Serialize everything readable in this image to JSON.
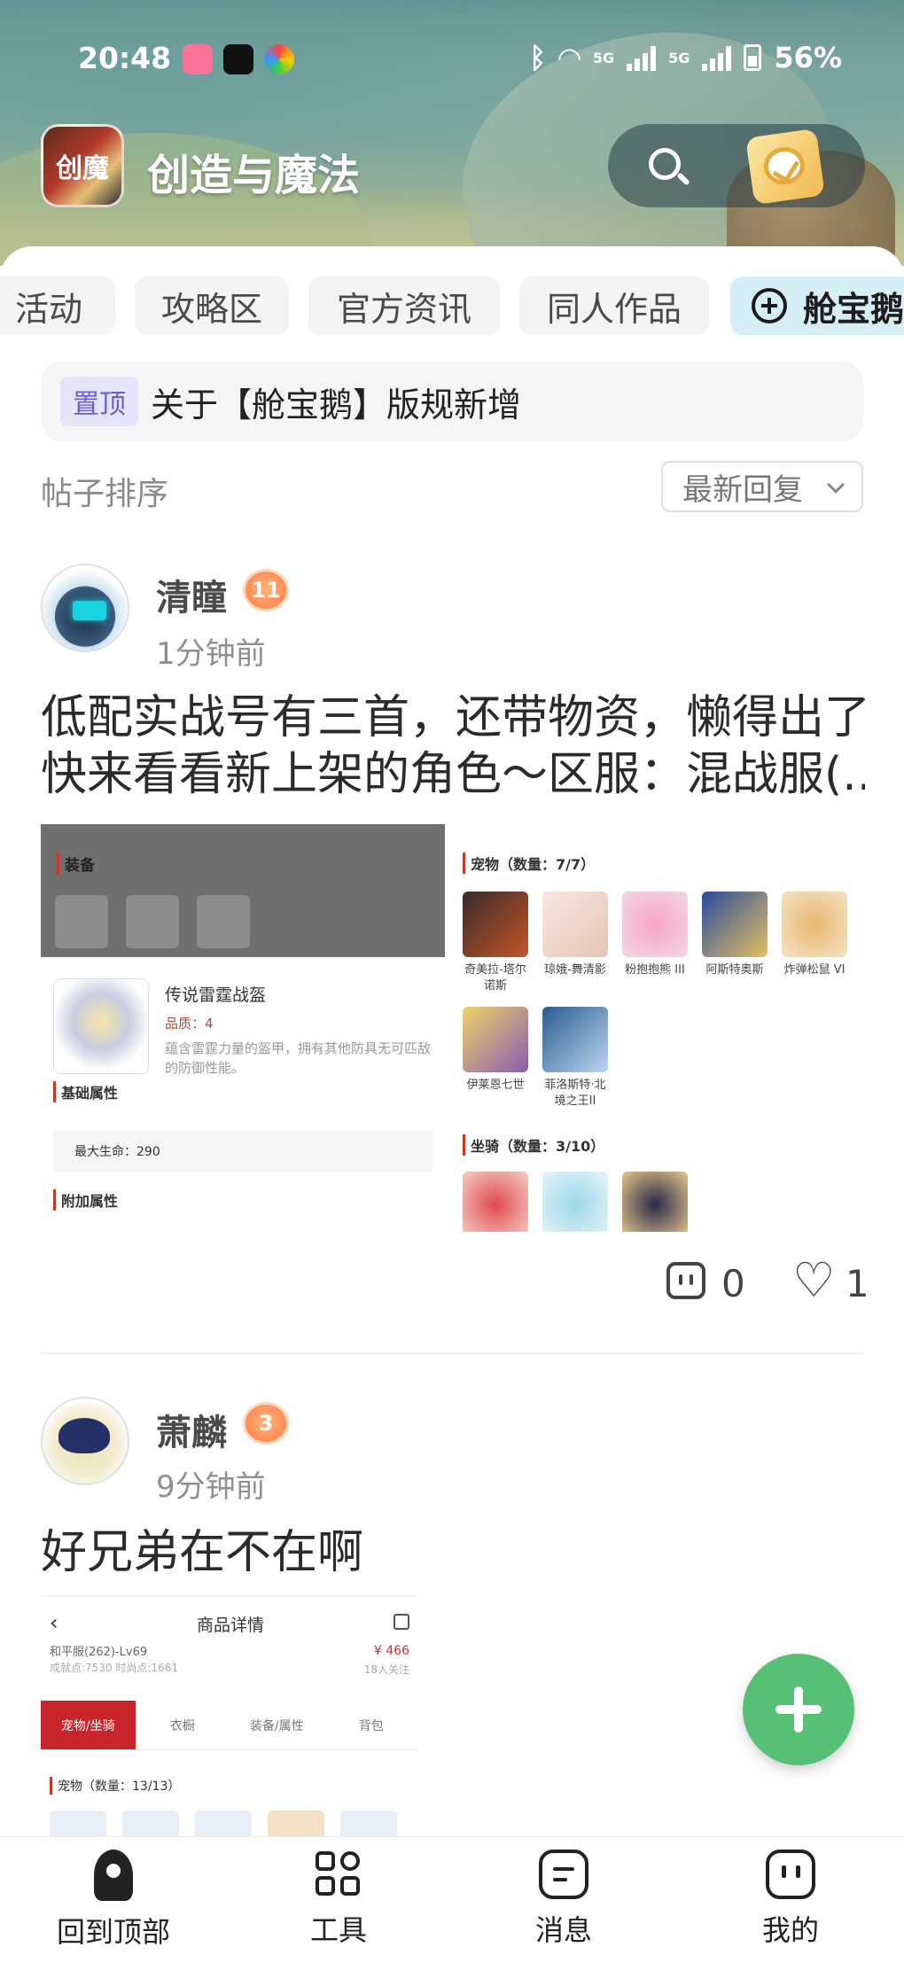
{
  "status_bar": {
    "time": "20:48",
    "network_1": "5G",
    "network_2": "5G",
    "battery": "56%"
  },
  "header": {
    "app_title": "创造与魔法",
    "logo_text": "创魔"
  },
  "tabs": [
    {
      "label": "活动"
    },
    {
      "label": "攻略区"
    },
    {
      "label": "官方资讯"
    },
    {
      "label": "同人作品"
    },
    {
      "label": "舱宝鹅",
      "active": true
    }
  ],
  "pinned": {
    "badge": "置顶",
    "text": "关于【舱宝鹅】版规新增"
  },
  "sort": {
    "label": "帖子排序",
    "selected": "最新回复"
  },
  "posts": [
    {
      "username": "清瞳",
      "level": "11",
      "time": "1分钟前",
      "text_line1": "低配实战号有三首，还带物资，懒得出了",
      "text_line2": "快来看看新上架的角色～区服：混战服(...",
      "comments": "0",
      "likes": "1",
      "screenshot": {
        "equip_title": "装备",
        "item_name": "传说雷霆战盔",
        "quality": "品质：4",
        "description": "蕴含雷霆力量的盔甲，拥有其他防具无可匹敌的防御性能。",
        "base_attr_title": "基础属性",
        "base_attr_row": "最大生命：290",
        "extra_attr_title": "附加属性",
        "pets_title": "宠物（数量：7/7）",
        "pets": [
          "奇美拉-塔尔诺斯",
          "琼娥-舞清影",
          "粉抱抱熊 III",
          "阿斯特奥斯",
          "炸弹松鼠 VI",
          "伊莱恩七世",
          "菲洛斯特·北境之王II"
        ],
        "mounts_title": "坐骑（数量：3/10）"
      }
    },
    {
      "username": "萧麟",
      "level": "3",
      "time": "9分钟前",
      "text_line1": "好兄弟在不在啊",
      "screenshot": {
        "back": "‹",
        "title": "商品详情",
        "line1": "和平服(262)-Lv69",
        "line2": "成就点:7530   时尚点:1661",
        "price": "¥ 466",
        "price_sub": "18人关注",
        "tabs": [
          "宠物/坐骑",
          "衣橱",
          "装备/属性",
          "背包"
        ],
        "pets_title": "宠物（数量：13/13）"
      }
    }
  ],
  "bottom_nav": [
    {
      "label": "回到顶部"
    },
    {
      "label": "工具"
    },
    {
      "label": "消息"
    },
    {
      "label": "我的"
    }
  ]
}
